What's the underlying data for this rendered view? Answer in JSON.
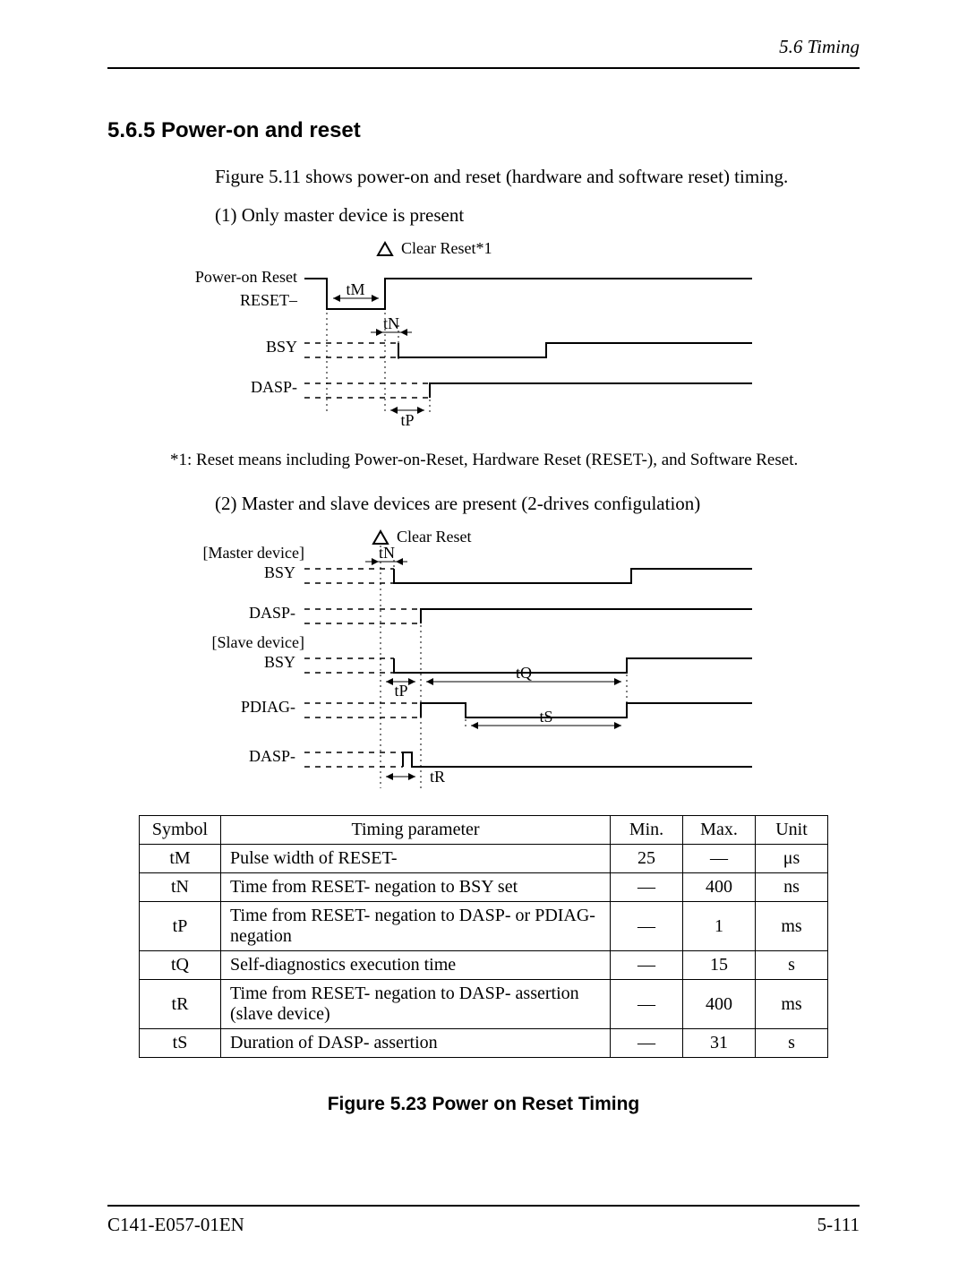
{
  "header": {
    "section_label": "5.6  Timing"
  },
  "heading": "5.6.5  Power-on and reset",
  "intro": "Figure 5.11 shows power-on and reset (hardware and software reset) timing.",
  "case1": {
    "label": "(1)  Only master device is present"
  },
  "case2": {
    "label": "(2)  Master and slave devices are present (2-drives configulation)"
  },
  "diagram1": {
    "clear_reset": "Clear Reset*1",
    "power_on_reset": "Power-on Reset",
    "reset_minus": "RESET–",
    "bsy": "BSY",
    "dasp": "DASP-",
    "tM": "tM",
    "tN": "tN",
    "tP": "tP"
  },
  "note1": "*1: Reset means including Power-on-Reset, Hardware Reset (RESET-), and Software Reset.",
  "diagram2": {
    "clear_reset": "Clear Reset",
    "master": "[Master device]",
    "slave": "[Slave device]",
    "bsy": "BSY",
    "dasp": "DASP-",
    "pdiag": "PDIAG-",
    "tN": "tN",
    "tP": "tP",
    "tQ": "tQ",
    "tR": "tR",
    "tS": "tS"
  },
  "table": {
    "headers": {
      "symbol": "Symbol",
      "param": "Timing parameter",
      "min": "Min.",
      "max": "Max.",
      "unit": "Unit"
    },
    "rows": [
      {
        "symbol": "tM",
        "param": "Pulse width of RESET-",
        "min": "25",
        "max": "—",
        "unit": "μs"
      },
      {
        "symbol": "tN",
        "param": "Time from RESET- negation to BSY set",
        "min": "—",
        "max": "400",
        "unit": "ns"
      },
      {
        "symbol": "tP",
        "param": "Time from RESET- negation to DASP- or PDIAG- negation",
        "min": "—",
        "max": "1",
        "unit": "ms"
      },
      {
        "symbol": "tQ",
        "param": "Self-diagnostics execution time",
        "min": "—",
        "max": "15",
        "unit": "s"
      },
      {
        "symbol": "tR",
        "param": "Time from RESET- negation to DASP- assertion (slave device)",
        "min": "—",
        "max": "400",
        "unit": "ms"
      },
      {
        "symbol": "tS",
        "param": "Duration of DASP- assertion",
        "min": "—",
        "max": "31",
        "unit": "s"
      }
    ]
  },
  "figure_caption": "Figure 5.23  Power on Reset Timing",
  "footer": {
    "doc_id": "C141-E057-01EN",
    "page": "5-111"
  }
}
